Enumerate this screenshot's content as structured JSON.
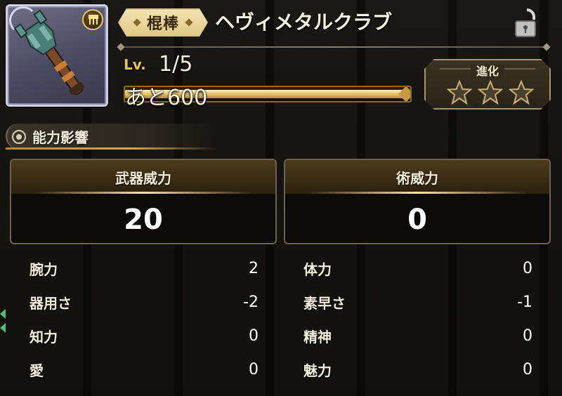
{
  "item": {
    "icon": "heavy-metal-club-icon",
    "equip_badge_icon": "equipment-badge-icon",
    "category": "棍棒",
    "name": "ヘヴィメタルクラブ",
    "locked": false,
    "lock_icon": "unlock-icon"
  },
  "level": {
    "label": "Lv.",
    "value": "1/5",
    "remaining": "あと600",
    "progress_fraction": 0.99
  },
  "evolution": {
    "title": "進化",
    "stars_total": 3,
    "stars_filled": 0
  },
  "section": {
    "title": "能力影響",
    "icon": "sun-icon"
  },
  "power": [
    {
      "label": "武器威力",
      "value": "20"
    },
    {
      "label": "術威力",
      "value": "0"
    }
  ],
  "stats_left": [
    {
      "name": "腕力",
      "value": "2"
    },
    {
      "name": "器用さ",
      "value": "-2"
    },
    {
      "name": "知力",
      "value": "0"
    },
    {
      "name": "愛",
      "value": "0"
    }
  ],
  "stats_right": [
    {
      "name": "体力",
      "value": "0"
    },
    {
      "name": "素早さ",
      "value": "-1"
    },
    {
      "name": "精神",
      "value": "0"
    },
    {
      "name": "魅力",
      "value": "0"
    }
  ],
  "colors": {
    "gold": "#e8c35a",
    "text": "#f4eede",
    "panel": "#0c0b0a"
  }
}
